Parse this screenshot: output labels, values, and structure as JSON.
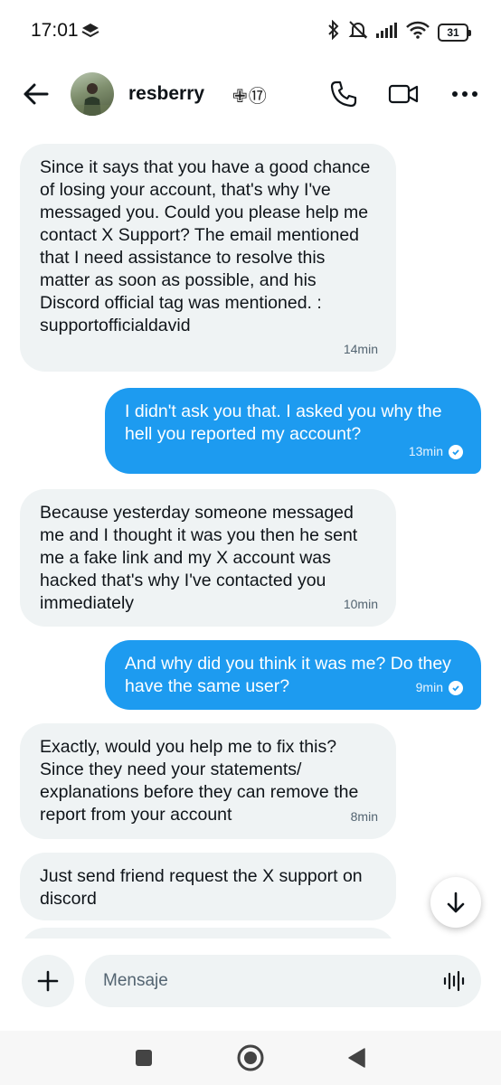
{
  "status_bar": {
    "time": "17:01",
    "battery": "31",
    "icons": [
      "layers-icon",
      "bluetooth-icon",
      "mute-bell-icon",
      "signal-icon",
      "wifi-icon",
      "battery-icon"
    ]
  },
  "header": {
    "username": "resberry",
    "badges": "✙⑰",
    "icons": [
      "back-arrow-icon",
      "phone-icon",
      "video-camera-icon",
      "more-icon"
    ]
  },
  "messages": [
    {
      "direction": "received",
      "text": "Since it says that you have a good chance of losing your account, that's why I've messaged you. Could you please help me contact X Support? The email mentioned that I need assistance to resolve this matter as soon as possible, and his Discord official tag was mentioned.  : supportofficialdavid",
      "time": "14min"
    },
    {
      "direction": "sent",
      "text": "I didn't ask you that. I asked you why the hell you reported my account?",
      "time": "13min",
      "read": true
    },
    {
      "direction": "received",
      "text": "Because yesterday someone messaged me and I thought it was you then he sent me a fake link and my X account was hacked that's why I've contacted you immediately",
      "time": "10min"
    },
    {
      "direction": "sent",
      "text": "And why did you think it was me? Do they have the same user?",
      "time": "9min",
      "read": true
    },
    {
      "direction": "received",
      "text": "Exactly, would you help me to fix this? Since they need your statements/ explanations before they can remove the report from your account",
      "time": "8min"
    },
    {
      "direction": "received",
      "text": "Just send friend request the X support on discord",
      "time": ""
    }
  ],
  "composer": {
    "placeholder": "Mensaje",
    "icons": [
      "plus-icon",
      "voice-wave-icon"
    ]
  },
  "colors": {
    "sent_bubble": "#1d9bf0",
    "received_bubble": "#eff3f4",
    "text": "#0f1419",
    "muted": "#536471"
  }
}
